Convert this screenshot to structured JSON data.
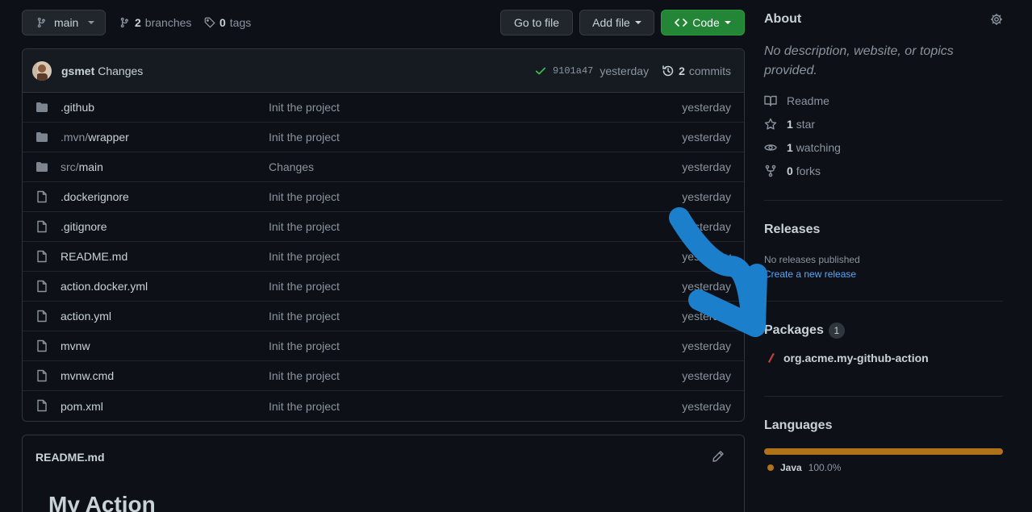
{
  "toolbar": {
    "branch": "main",
    "branches_count": "2",
    "branches_label": "branches",
    "tags_count": "0",
    "tags_label": "tags",
    "goto_file": "Go to file",
    "add_file": "Add file",
    "code": "Code"
  },
  "commit": {
    "author": "gsmet",
    "message": "Changes",
    "sha": "9101a47",
    "time": "yesterday",
    "commits_count": "2",
    "commits_label": "commits"
  },
  "files": [
    {
      "type": "dir",
      "prefix": "",
      "name": ".github",
      "message": "Init the project",
      "date": "yesterday"
    },
    {
      "type": "dir",
      "prefix": ".mvn/",
      "name": "wrapper",
      "message": "Init the project",
      "date": "yesterday"
    },
    {
      "type": "dir",
      "prefix": "src/",
      "name": "main",
      "message": "Changes",
      "date": "yesterday"
    },
    {
      "type": "file",
      "prefix": "",
      "name": ".dockerignore",
      "message": "Init the project",
      "date": "yesterday"
    },
    {
      "type": "file",
      "prefix": "",
      "name": ".gitignore",
      "message": "Init the project",
      "date": "yesterday"
    },
    {
      "type": "file",
      "prefix": "",
      "name": "README.md",
      "message": "Init the project",
      "date": "yesterday"
    },
    {
      "type": "file",
      "prefix": "",
      "name": "action.docker.yml",
      "message": "Init the project",
      "date": "yesterday"
    },
    {
      "type": "file",
      "prefix": "",
      "name": "action.yml",
      "message": "Init the project",
      "date": "yesterday"
    },
    {
      "type": "file",
      "prefix": "",
      "name": "mvnw",
      "message": "Init the project",
      "date": "yesterday"
    },
    {
      "type": "file",
      "prefix": "",
      "name": "mvnw.cmd",
      "message": "Init the project",
      "date": "yesterday"
    },
    {
      "type": "file",
      "prefix": "",
      "name": "pom.xml",
      "message": "Init the project",
      "date": "yesterday"
    }
  ],
  "readme": {
    "filename": "README.md",
    "heading": "My Action"
  },
  "sidebar": {
    "about_title": "About",
    "about_desc": "No description, website, or topics provided.",
    "readme_label": "Readme",
    "stars_count": "1",
    "stars_label": "star",
    "watching_count": "1",
    "watching_label": "watching",
    "forks_count": "0",
    "forks_label": "forks",
    "releases_title": "Releases",
    "no_releases": "No releases published",
    "create_release": "Create a new release",
    "packages_title": "Packages",
    "packages_count": "1",
    "package_name": "org.acme.my-github-action",
    "languages_title": "Languages",
    "language_name": "Java",
    "language_percent": "100.0%"
  },
  "colors": {
    "background": "#0d1117",
    "green_button": "#238636",
    "link": "#58a6ff",
    "java": "#b07219",
    "annotation_arrow": "#1b7fcc"
  }
}
